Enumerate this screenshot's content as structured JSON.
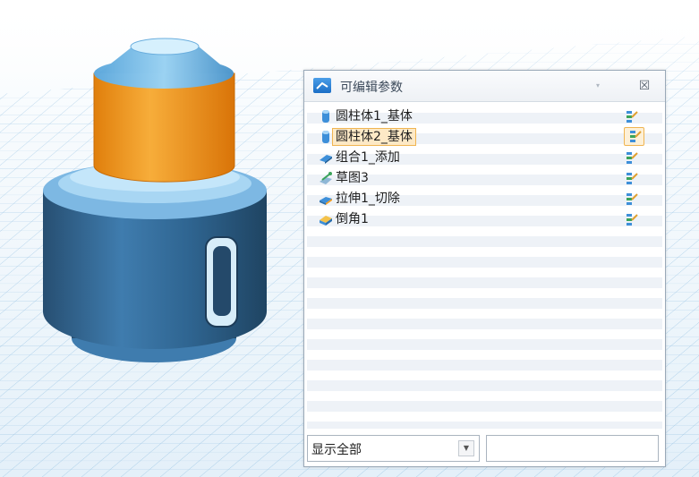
{
  "panel": {
    "title": "可编辑参数",
    "close_glyph": "☒",
    "icon": "panel-params-icon"
  },
  "features": [
    {
      "label": "圆柱体1_基体",
      "icon": "cylinder-icon",
      "selected": false
    },
    {
      "label": "圆柱体2_基体",
      "icon": "cylinder-icon",
      "selected": true
    },
    {
      "label": "组合1_添加",
      "icon": "combine-add-icon",
      "selected": false
    },
    {
      "label": "草图3",
      "icon": "sketch-icon",
      "selected": false
    },
    {
      "label": "拉伸1_切除",
      "icon": "extrude-cut-icon",
      "selected": false
    },
    {
      "label": "倒角1",
      "icon": "chamfer-icon",
      "selected": false
    }
  ],
  "filter": {
    "value": "显示全部",
    "arrow": "▼"
  },
  "search": {
    "value": ""
  },
  "colors": {
    "accent_blue": "#3d8fd9",
    "part_orange": "#f29b1d",
    "part_blue": "#3f7cae",
    "selection_fill": "#fde9c6",
    "selection_border": "#f0b552"
  }
}
